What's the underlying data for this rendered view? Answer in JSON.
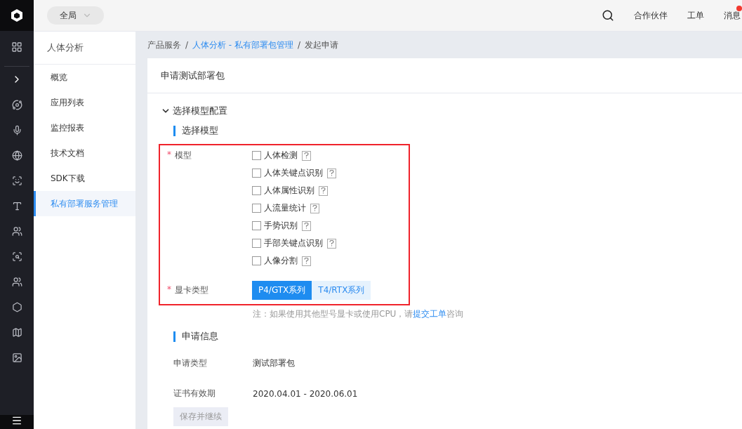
{
  "top_bar": {
    "scope": "全局",
    "links": [
      "合作伙伴",
      "工单"
    ],
    "messages": {
      "label": "消息",
      "unread": true
    }
  },
  "sidebar": {
    "title": "人体分析",
    "items": [
      {
        "label": "概览",
        "selected": false
      },
      {
        "label": "应用列表",
        "selected": false
      },
      {
        "label": "监控报表",
        "selected": false
      },
      {
        "label": "技术文档",
        "selected": false
      },
      {
        "label": "SDK下载",
        "selected": false
      },
      {
        "label": "私有部署服务管理",
        "selected": true
      }
    ]
  },
  "breadcrumb": [
    {
      "label": "产品服务",
      "link": false
    },
    {
      "separator": "/",
      "label": "人体分析 - 私有部署包管理",
      "link": true
    },
    {
      "separator": "/",
      "label": "发起申请",
      "link": false
    }
  ],
  "card_title": "申请测试部署包",
  "section": {
    "title": "选择模型配置",
    "expanded": true
  },
  "model_group": {
    "title": "选择模型",
    "required_mark": "*",
    "model_label": "模型",
    "models": [
      {
        "label": "人体检测",
        "checked": false
      },
      {
        "label": "人体关键点识别",
        "checked": false
      },
      {
        "label": "人体属性识别",
        "checked": false
      },
      {
        "label": "人流量统计",
        "checked": false
      },
      {
        "label": "手势识别",
        "checked": false
      },
      {
        "label": "手部关键点识别",
        "checked": false
      },
      {
        "label": "人像分割",
        "checked": false
      }
    ],
    "gpu_label": "显卡类型",
    "gpu_options": [
      {
        "label": "P4/GTX系列",
        "selected": true
      },
      {
        "label": "T4/RTX系列",
        "selected": false
      }
    ],
    "note": "注：如果使用其他型号显卡或使用CPU，请",
    "note_link": "提交工单",
    "note_end": "咨询"
  },
  "info_group": {
    "title": "申请信息",
    "rows": [
      {
        "label": "申请类型",
        "value": "测试部署包"
      },
      {
        "label": "证书有效期",
        "value": "2020.04.01 - 2020.06.01"
      }
    ]
  },
  "save_button": {
    "label": "保存并继续",
    "disabled": true
  }
}
